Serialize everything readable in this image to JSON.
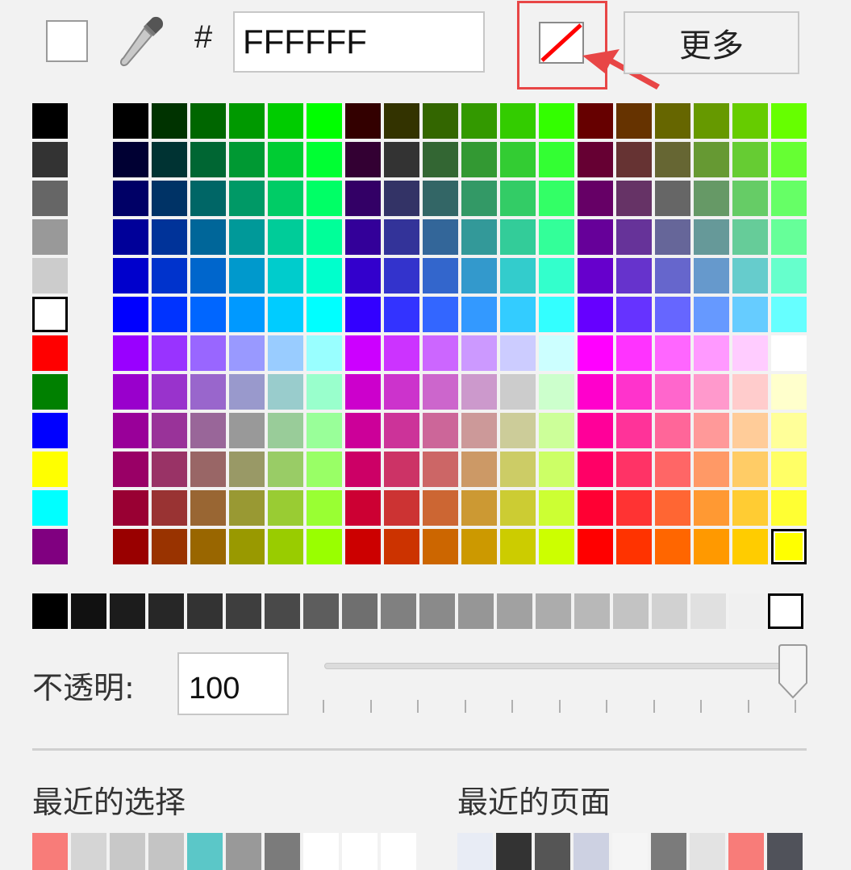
{
  "header": {
    "hash_symbol": "#",
    "hex_value": "FFFFFF",
    "more_label": "更多",
    "current_color": "#FFFFFF"
  },
  "accent": {
    "highlight": "#E84646",
    "no_color_slash": "#FF0000"
  },
  "left_column": [
    "#000000",
    "#333333",
    "#666666",
    "#999999",
    "#CCCCCC",
    "#FFFFFF",
    "#FF0000",
    "#008000",
    "#0000FF",
    "#FFFF00",
    "#00FFFF",
    "#800080"
  ],
  "left_column_selected_index": 5,
  "palette_grid_selected": [
    11,
    17
  ],
  "grayscale_row": [
    "#000000",
    "#111111",
    "#1C1C1C",
    "#272727",
    "#333333",
    "#3E3E3E",
    "#494949",
    "#5D5D5D",
    "#6F6F6F",
    "#808080",
    "#8A8A8A",
    "#969696",
    "#A1A1A1",
    "#ACACAC",
    "#B8B8B8",
    "#C3C3C3",
    "#D1D1D1",
    "#E0E0E0",
    "#F0F0F0",
    "#FFFFFF"
  ],
  "grayscale_selected_index": 19,
  "opacity": {
    "label": "不透明:",
    "value": "100",
    "percent": 100
  },
  "recent": {
    "label": "最近的选择",
    "colors": [
      "#F87C79",
      "#D5D5D5",
      "#C8C8C8",
      "#C4C4C4",
      "#5BC7C8",
      "#999999",
      "#7B7B7B",
      "#FFFFFF",
      "#FFFFFF",
      "#FFFFFF"
    ]
  },
  "page_colors": {
    "label": "最近的页面",
    "colors": [
      "#E8ECF5",
      "#333333",
      "#555555",
      "#CDD1E2",
      "#F5F5F5",
      "#7B7B7B",
      "#E3E3E3",
      "#F87C79",
      "#50525A"
    ]
  }
}
